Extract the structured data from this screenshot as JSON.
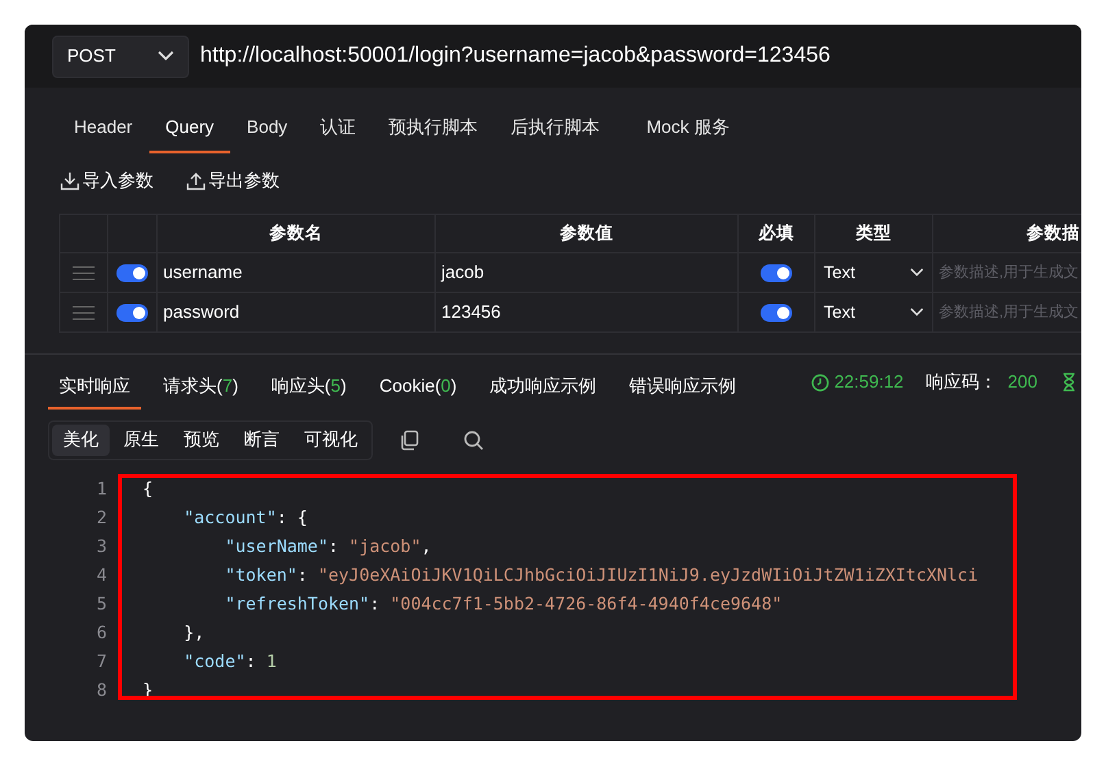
{
  "request": {
    "method": "POST",
    "url": "http://localhost:50001/login?username=jacob&password=123456"
  },
  "request_tabs": [
    {
      "label": "Header",
      "selected": false
    },
    {
      "label": "Query",
      "selected": true
    },
    {
      "label": "Body",
      "selected": false
    },
    {
      "label": "认证",
      "selected": false
    },
    {
      "label": "预执行脚本",
      "selected": false
    },
    {
      "label": "后执行脚本",
      "selected": false
    },
    {
      "label": "Mock 服务",
      "selected": false
    }
  ],
  "param_tools": [
    {
      "kind": "import",
      "label": "导入参数"
    },
    {
      "kind": "export",
      "label": "导出参数"
    }
  ],
  "params_table": {
    "columns": [
      "参数名",
      "参数值",
      "必填",
      "类型",
      "参数描"
    ],
    "rows": [
      {
        "enabled": true,
        "name": "username",
        "value": "jacob",
        "required": true,
        "type": "Text",
        "description_placeholder": "参数描述,用于生成文"
      },
      {
        "enabled": true,
        "name": "password",
        "value": "123456",
        "required": true,
        "type": "Text",
        "description_placeholder": "参数描述,用于生成文"
      }
    ]
  },
  "response_tabs": [
    {
      "label": "实时响应",
      "selected": true
    },
    {
      "label": "请求头",
      "count": "(7)",
      "selected": false
    },
    {
      "label": "响应头",
      "count": "(5)",
      "selected": false
    },
    {
      "label": "Cookie",
      "count": "(0)",
      "selected": false
    },
    {
      "label": "成功响应示例",
      "selected": false
    },
    {
      "label": "错误响应示例",
      "selected": false
    }
  ],
  "response_status": {
    "time": "22:59:12",
    "code_label": "响应码：",
    "code": "200"
  },
  "view_tabs": [
    {
      "label": "美化",
      "selected": true
    },
    {
      "label": "原生",
      "selected": false
    },
    {
      "label": "预览",
      "selected": false
    },
    {
      "label": "断言",
      "selected": false
    },
    {
      "label": "可视化",
      "selected": false
    }
  ],
  "code": {
    "highlighted": true,
    "lines": [
      {
        "number": "1",
        "text": "{"
      },
      {
        "number": "2",
        "text": "    \"account\": {"
      },
      {
        "number": "3",
        "text": "        \"userName\": \"jacob\","
      },
      {
        "number": "4",
        "text": "        \"token\": \"eyJ0eXAiOiJKV1QiLCJhbGciOiJIUzI1NiJ9.eyJzdWIiOiJtZW1iZXItcXNlci"
      },
      {
        "number": "5",
        "text": "        \"refreshToken\": \"004cc7f1-5bb2-4726-86f4-4940f4ce9648\""
      },
      {
        "number": "6",
        "text": "    },"
      },
      {
        "number": "7",
        "text": "    \"code\": 1"
      },
      {
        "number": "8",
        "text": "}"
      }
    ]
  }
}
